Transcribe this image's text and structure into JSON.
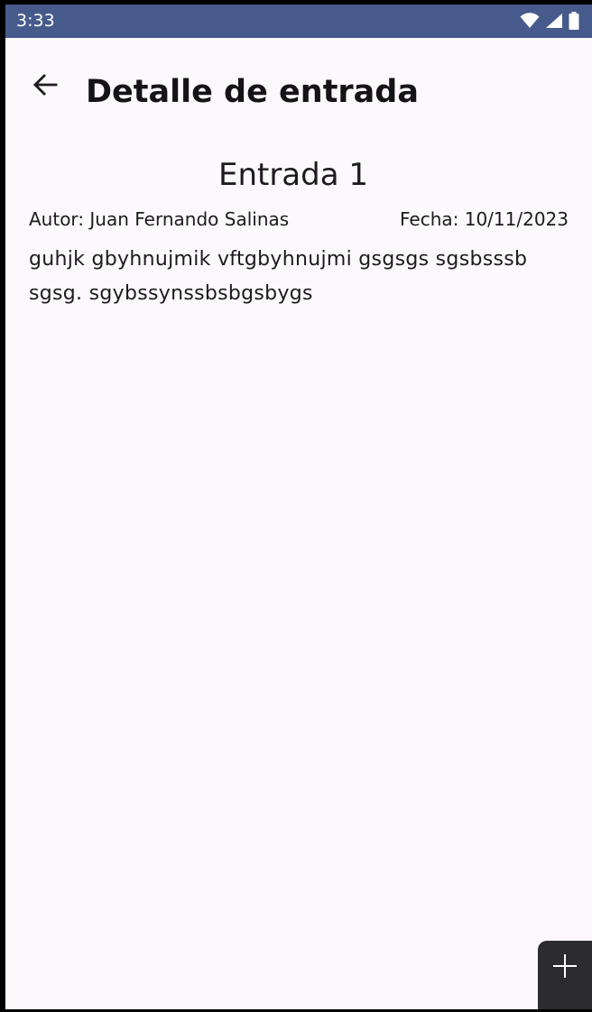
{
  "status_bar": {
    "time": "3:33",
    "icons": [
      "wifi-icon",
      "cellular-signal-icon",
      "battery-icon"
    ]
  },
  "app_bar": {
    "back_icon": "arrow-left-icon",
    "title": "Detalle de entrada"
  },
  "entry": {
    "title": "Entrada 1",
    "author": "Autor: Juan Fernando Salinas",
    "date": "Fecha: 10/11/2023",
    "body": "guhjk gbyhnujmik vftgbyhnujmi gsgsgs sgsbsssb sgsg. sgybssynssbsbgsbygs"
  },
  "fab": {
    "icon": "plus-icon"
  },
  "colors": {
    "status_bar": "#475a8c",
    "background": "#fcf8fc",
    "fab": "#2c2c30",
    "text": "#1c1b1f"
  }
}
